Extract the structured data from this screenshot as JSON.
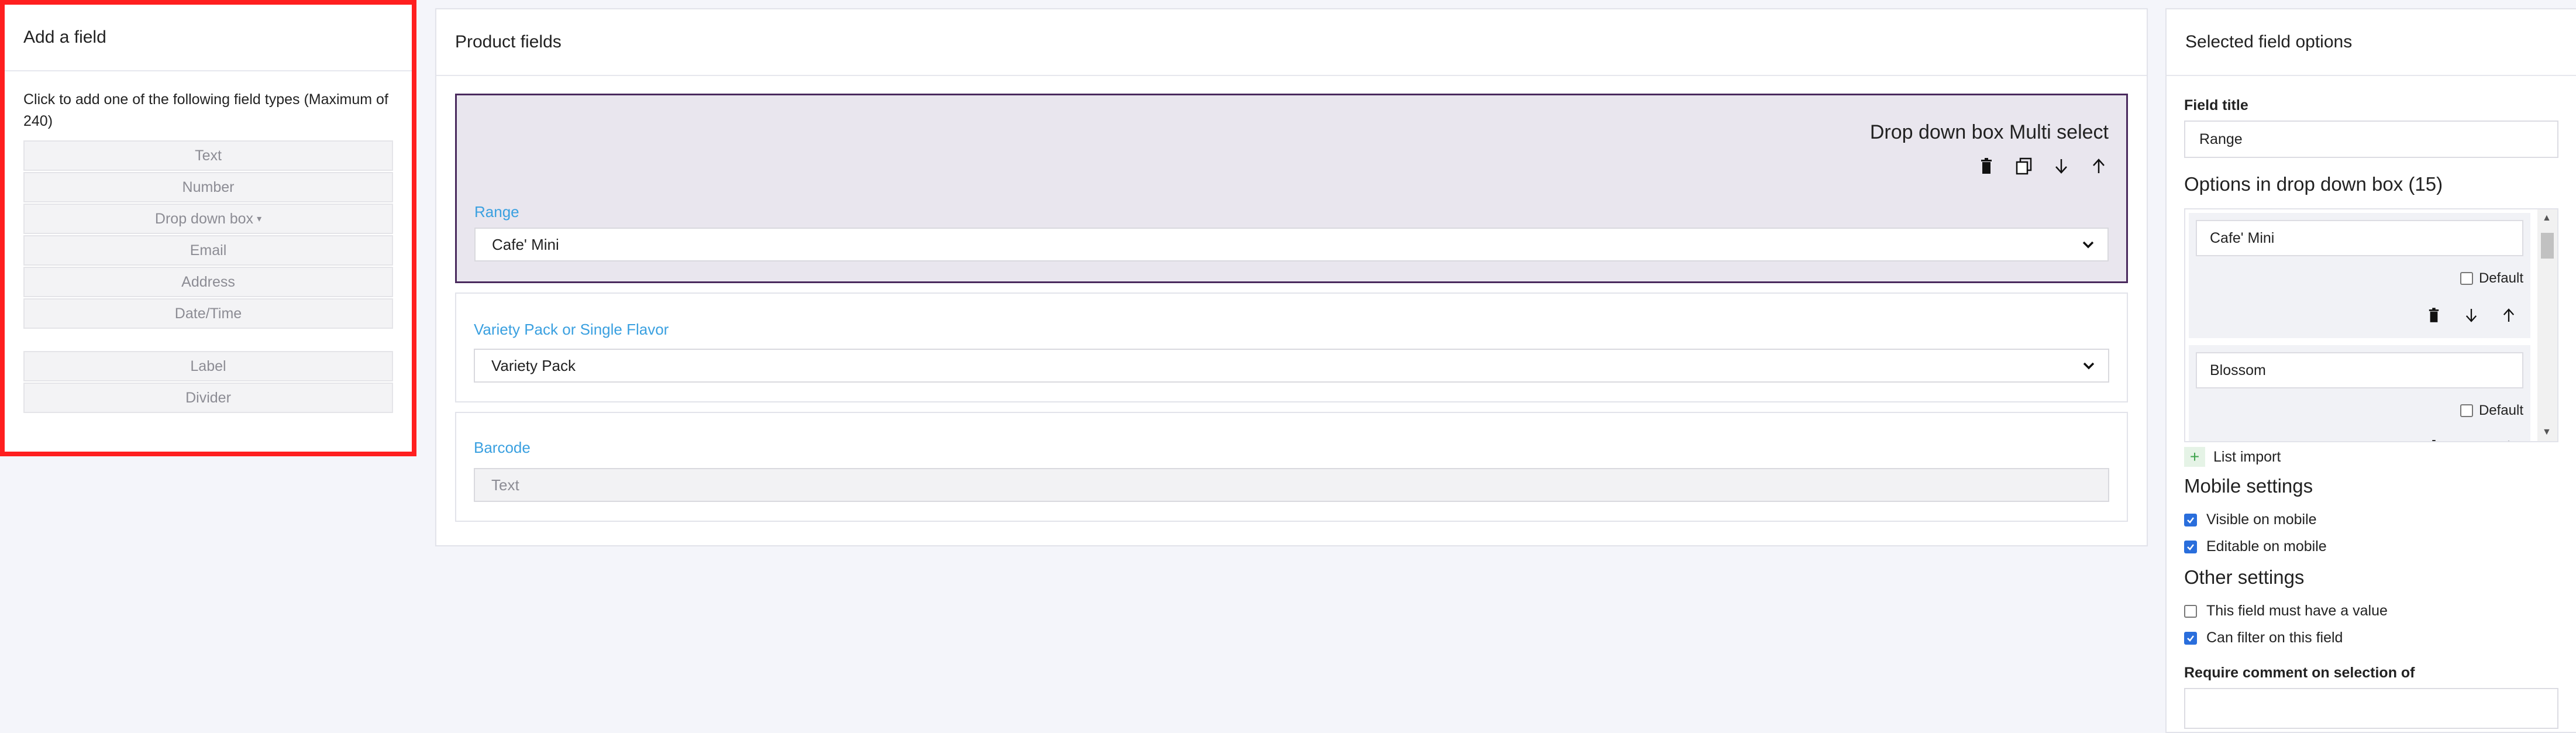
{
  "left_panel": {
    "title": "Add a field",
    "description": "Click to add one of the following field types (Maximum of 240)",
    "field_types": [
      "Text",
      "Number",
      "Drop down box",
      "Email",
      "Address",
      "Date/Time"
    ],
    "extra_types": [
      "Label",
      "Divider"
    ]
  },
  "center_panel": {
    "title": "Product fields",
    "fields": [
      {
        "card_title": "Drop down box Multi select",
        "label": "Range",
        "value": "Cafe' Mini"
      },
      {
        "label": "Variety Pack or Single Flavor",
        "value": "Variety Pack"
      },
      {
        "label": "Barcode",
        "placeholder": "Text"
      }
    ]
  },
  "right_panel": {
    "title": "Selected field options",
    "field_title_label": "Field title",
    "field_title_value": "Range",
    "options_heading": "Options in drop down box (15)",
    "options": [
      {
        "value": "Cafe' Mini",
        "default_label": "Default",
        "default_checked": false
      },
      {
        "value": "Blossom",
        "default_label": "Default",
        "default_checked": false
      }
    ],
    "list_import_label": "List import",
    "mobile_heading": "Mobile settings",
    "mobile_settings": [
      {
        "label": "Visible on mobile",
        "checked": true
      },
      {
        "label": "Editable on mobile",
        "checked": true
      }
    ],
    "other_heading": "Other settings",
    "other_settings": [
      {
        "label": "This field must have a value",
        "checked": false
      },
      {
        "label": "Can filter on this field",
        "checked": true
      }
    ],
    "require_comment_label": "Require comment on selection of",
    "require_comment_value": ""
  },
  "colors": {
    "highlight_border": "#ff1f1f",
    "selected_card_bg": "#e9e6ee",
    "selected_card_border": "#4a2a5e",
    "field_label": "#3aa0e0",
    "checkbox_checked": "#2a6edc"
  }
}
